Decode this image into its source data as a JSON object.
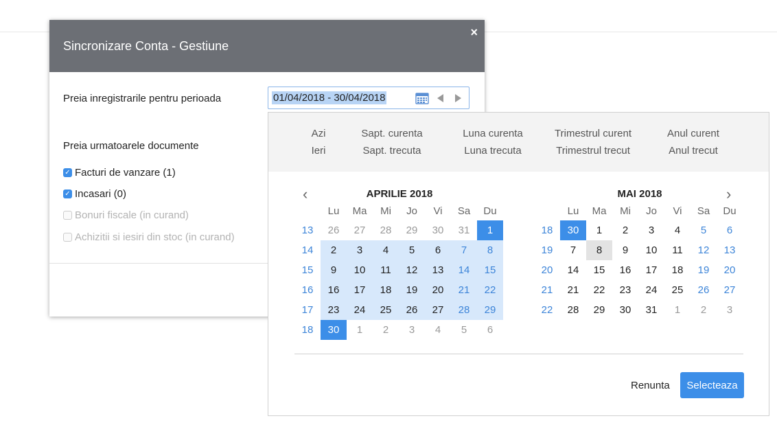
{
  "modal": {
    "title": "Sincronizare Conta - Gestiune",
    "close": "×",
    "period_label": "Preia inregistrarile pentru perioada",
    "date_value": "01/04/2018 - 30/04/2018",
    "documents_label": "Preia urmatoarele documente",
    "checkboxes": [
      {
        "label": "Facturi de vanzare (1)",
        "checked": true,
        "disabled": false
      },
      {
        "label": "Incasari (0)",
        "checked": true,
        "disabled": false
      },
      {
        "label": "Bonuri fiscale (in curand)",
        "checked": false,
        "disabled": true
      },
      {
        "label": "Achizitii si iesiri din stoc (in curand)",
        "checked": false,
        "disabled": true
      }
    ]
  },
  "picker": {
    "presets": [
      [
        "Azi",
        "Ieri"
      ],
      [
        "Sapt. curenta",
        "Sapt. trecuta"
      ],
      [
        "Luna curenta",
        "Luna trecuta"
      ],
      [
        "Trimestrul curent",
        "Trimestrul trecut"
      ],
      [
        "Anul curent",
        "Anul trecut"
      ]
    ],
    "prev_icon": "‹",
    "next_icon": "›",
    "weekdays": [
      "Lu",
      "Ma",
      "Mi",
      "Jo",
      "Vi",
      "Sa",
      "Du"
    ],
    "months": [
      {
        "title": "APRILIE 2018",
        "weeks": [
          {
            "wk": "13",
            "days": [
              [
                "26",
                "other"
              ],
              [
                "27",
                "other"
              ],
              [
                "28",
                "other"
              ],
              [
                "29",
                "other"
              ],
              [
                "30",
                "other"
              ],
              [
                "31",
                "other"
              ],
              [
                "1",
                "sel"
              ]
            ]
          },
          {
            "wk": "14",
            "days": [
              [
                "2",
                "range"
              ],
              [
                "3",
                "range"
              ],
              [
                "4",
                "range"
              ],
              [
                "5",
                "range"
              ],
              [
                "6",
                "range"
              ],
              [
                "7",
                "range weekend"
              ],
              [
                "8",
                "range weekend"
              ]
            ]
          },
          {
            "wk": "15",
            "days": [
              [
                "9",
                "range"
              ],
              [
                "10",
                "range"
              ],
              [
                "11",
                "range"
              ],
              [
                "12",
                "range"
              ],
              [
                "13",
                "range"
              ],
              [
                "14",
                "range weekend"
              ],
              [
                "15",
                "range weekend"
              ]
            ]
          },
          {
            "wk": "16",
            "days": [
              [
                "16",
                "range"
              ],
              [
                "17",
                "range"
              ],
              [
                "18",
                "range"
              ],
              [
                "19",
                "range"
              ],
              [
                "20",
                "range"
              ],
              [
                "21",
                "range weekend"
              ],
              [
                "22",
                "range weekend"
              ]
            ]
          },
          {
            "wk": "17",
            "days": [
              [
                "23",
                "range"
              ],
              [
                "24",
                "range"
              ],
              [
                "25",
                "range"
              ],
              [
                "26",
                "range"
              ],
              [
                "27",
                "range"
              ],
              [
                "28",
                "range weekend"
              ],
              [
                "29",
                "range weekend"
              ]
            ]
          },
          {
            "wk": "18",
            "days": [
              [
                "30",
                "sel"
              ],
              [
                "1",
                "other"
              ],
              [
                "2",
                "other"
              ],
              [
                "3",
                "other"
              ],
              [
                "4",
                "other"
              ],
              [
                "5",
                "other"
              ],
              [
                "6",
                "other"
              ]
            ]
          }
        ]
      },
      {
        "title": "MAI 2018",
        "weeks": [
          {
            "wk": "18",
            "days": [
              [
                "30",
                "sel"
              ],
              [
                "1",
                ""
              ],
              [
                "2",
                ""
              ],
              [
                "3",
                ""
              ],
              [
                "4",
                ""
              ],
              [
                "5",
                "weekend"
              ],
              [
                "6",
                "weekend"
              ]
            ]
          },
          {
            "wk": "19",
            "days": [
              [
                "7",
                ""
              ],
              [
                "8",
                "today"
              ],
              [
                "9",
                ""
              ],
              [
                "10",
                ""
              ],
              [
                "11",
                ""
              ],
              [
                "12",
                "weekend"
              ],
              [
                "13",
                "weekend"
              ]
            ]
          },
          {
            "wk": "20",
            "days": [
              [
                "14",
                ""
              ],
              [
                "15",
                ""
              ],
              [
                "16",
                ""
              ],
              [
                "17",
                ""
              ],
              [
                "18",
                ""
              ],
              [
                "19",
                "weekend"
              ],
              [
                "20",
                "weekend"
              ]
            ]
          },
          {
            "wk": "21",
            "days": [
              [
                "21",
                ""
              ],
              [
                "22",
                ""
              ],
              [
                "23",
                ""
              ],
              [
                "24",
                ""
              ],
              [
                "25",
                ""
              ],
              [
                "26",
                "weekend"
              ],
              [
                "27",
                "weekend"
              ]
            ]
          },
          {
            "wk": "22",
            "days": [
              [
                "28",
                ""
              ],
              [
                "29",
                ""
              ],
              [
                "30",
                ""
              ],
              [
                "31",
                ""
              ],
              [
                "1",
                "other"
              ],
              [
                "2",
                "other"
              ],
              [
                "3",
                "other"
              ]
            ]
          }
        ]
      }
    ],
    "cancel_label": "Renunta",
    "select_label": "Selecteaza"
  }
}
